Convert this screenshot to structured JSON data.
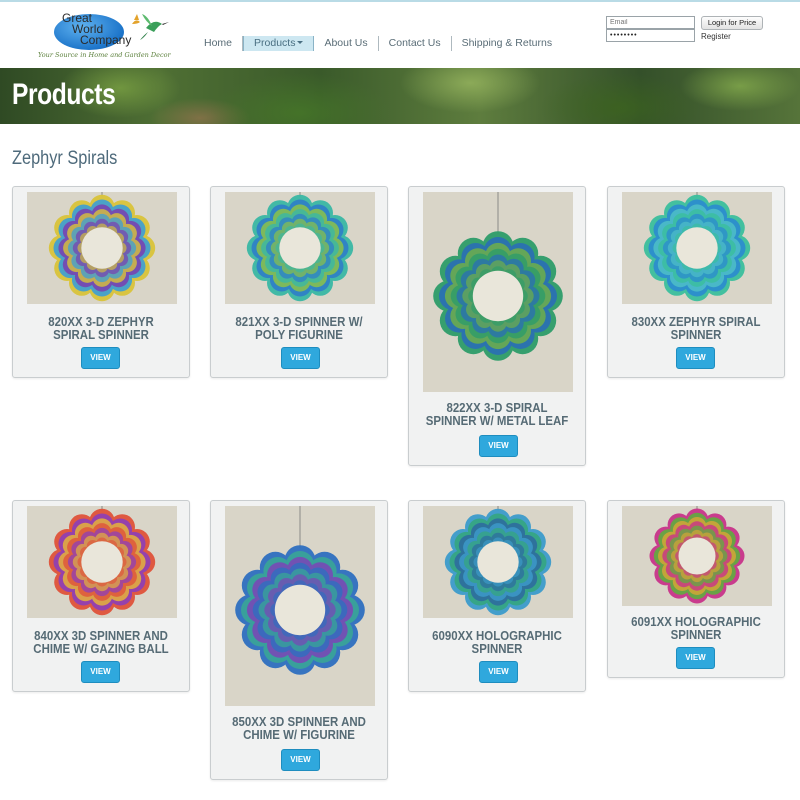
{
  "brand": {
    "line1": "Great",
    "line2": "World",
    "line3": "Company",
    "tagline": "Your Source in Home and Garden Decor"
  },
  "nav": {
    "items": [
      {
        "label": "Home"
      },
      {
        "label": "Products"
      },
      {
        "label": "About Us"
      },
      {
        "label": "Contact Us"
      },
      {
        "label": "Shipping & Returns"
      }
    ]
  },
  "login": {
    "email_placeholder": "Email",
    "password_value": "••••••••",
    "button_label": "Login for Price",
    "register_label": "Register"
  },
  "banner": {
    "title": "Products"
  },
  "section": {
    "title": "Zephyr Spirals"
  },
  "products": [
    {
      "title": "820xx 3-D Zephyr Spiral Spinner",
      "button": "VIEW",
      "colors": [
        "#d9c43a",
        "#3c9fd6",
        "#7a3fb0"
      ]
    },
    {
      "title": "821XX 3-D Spinner w/ Poly Figurine",
      "button": "VIEW",
      "colors": [
        "#3ab8a5",
        "#2f7fc8",
        "#8bc34a"
      ]
    },
    {
      "title": "822XX 3-D Spiral Spinner w/ Metal Leaf",
      "button": "VIEW",
      "colors": [
        "#2e9d6a",
        "#2a6fb5",
        "#6fb04a"
      ]
    },
    {
      "title": "830xx Zephyr Spiral Spinner",
      "button": "VIEW",
      "colors": [
        "#3bbf9d",
        "#2b8bd0",
        "#4fc0c8"
      ]
    },
    {
      "title": "840XX 3D Spinner and Chime w/ Gazing Ball",
      "button": "VIEW",
      "colors": [
        "#e0533a",
        "#8e3fb8",
        "#e7b23a"
      ]
    },
    {
      "title": "850XX 3D Spinner and Chime w/ Figurine",
      "button": "VIEW",
      "colors": [
        "#2f6fc0",
        "#3aa597",
        "#7b45b8"
      ]
    },
    {
      "title": "6090XX Holographic Spinner",
      "button": "VIEW",
      "colors": [
        "#3d9ccc",
        "#35a680",
        "#2d6aa0"
      ]
    },
    {
      "title": "6091XX Holographic Spinner",
      "button": "VIEW",
      "colors": [
        "#c9348a",
        "#5fae3f",
        "#d3a637"
      ]
    }
  ]
}
